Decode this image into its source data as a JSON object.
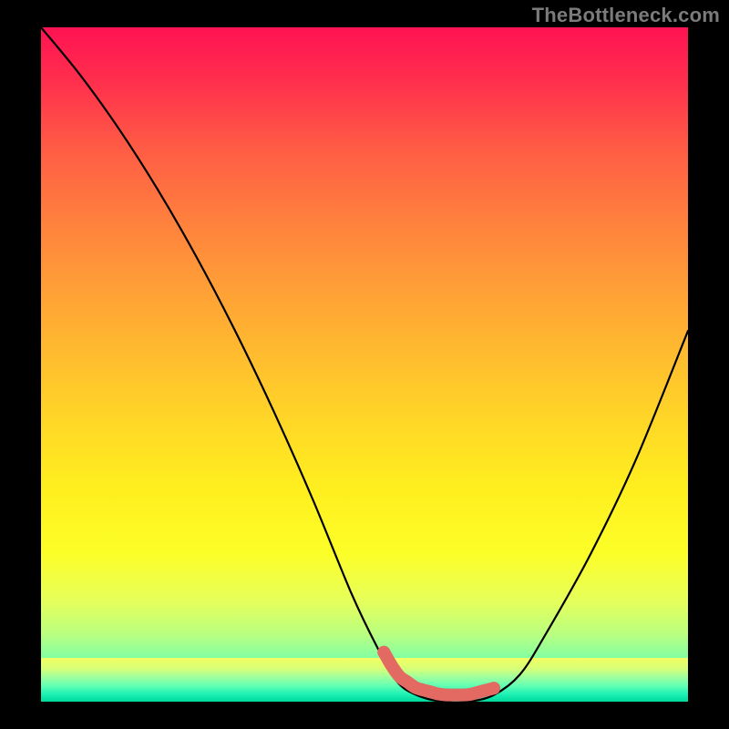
{
  "watermark": "TheBottleneck.com",
  "chart_data": {
    "type": "line",
    "title": "",
    "xlabel": "",
    "ylabel": "",
    "xlim": [
      0,
      100
    ],
    "ylim": [
      0,
      100
    ],
    "grid": false,
    "legend": false,
    "series": [
      {
        "name": "bottleneck-curve",
        "x": [
          0,
          6,
          12,
          18,
          24,
          30,
          36,
          42,
          48,
          52,
          55,
          58,
          62,
          66,
          70,
          74,
          78,
          85,
          92,
          100
        ],
        "values": [
          100,
          93,
          85,
          76,
          66,
          55,
          43,
          30,
          16,
          8,
          3,
          1,
          0,
          0,
          1,
          4,
          10,
          22,
          36,
          55
        ]
      }
    ],
    "highlight": {
      "name": "optimal-zone",
      "x_start": 53,
      "x_end": 70,
      "y": 1.5,
      "color": "#e26a63"
    },
    "background": "rainbow-vertical-gradient"
  }
}
